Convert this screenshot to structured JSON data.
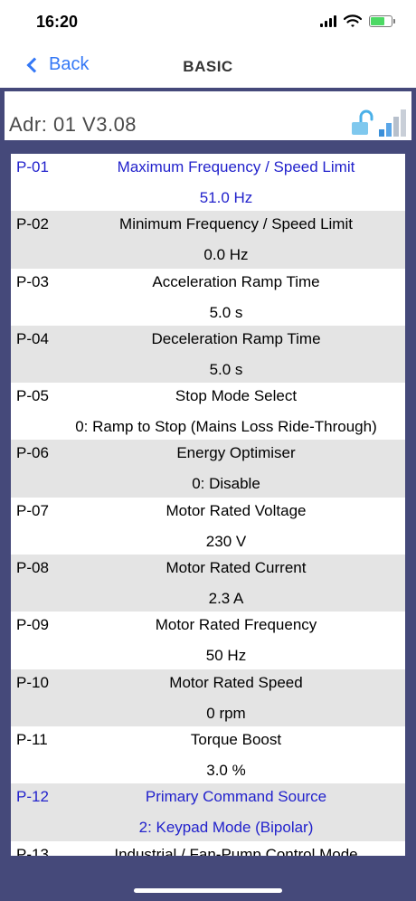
{
  "status_bar": {
    "time": "16:20"
  },
  "nav": {
    "back_label": "Back",
    "title": "BASIC"
  },
  "device": {
    "address": "Adr: 01 V3.08",
    "lock_icon": "unlocked-lock-icon",
    "signal_icon": "signal-strength-icon"
  },
  "colors": {
    "frame": "#45497a",
    "highlight_text": "#2222cc",
    "alt_row": "#e4e4e4",
    "link": "#3478f6"
  },
  "params": [
    {
      "code": "P-01",
      "name": "Maximum Frequency / Speed Limit",
      "value": "51.0 Hz",
      "highlight": true
    },
    {
      "code": "P-02",
      "name": "Minimum Frequency / Speed Limit",
      "value": "0.0 Hz",
      "highlight": false
    },
    {
      "code": "P-03",
      "name": "Acceleration Ramp Time",
      "value": "5.0 s",
      "highlight": false
    },
    {
      "code": "P-04",
      "name": "Deceleration Ramp Time",
      "value": "5.0 s",
      "highlight": false
    },
    {
      "code": "P-05",
      "name": "Stop Mode Select",
      "value": "0: Ramp to Stop (Mains Loss Ride-Through)",
      "highlight": false
    },
    {
      "code": "P-06",
      "name": "Energy Optimiser",
      "value": "0: Disable",
      "highlight": false
    },
    {
      "code": "P-07",
      "name": "Motor Rated Voltage",
      "value": "230 V",
      "highlight": false
    },
    {
      "code": "P-08",
      "name": "Motor Rated Current",
      "value": "2.3 A",
      "highlight": false
    },
    {
      "code": "P-09",
      "name": "Motor Rated Frequency",
      "value": "50 Hz",
      "highlight": false
    },
    {
      "code": "P-10",
      "name": "Motor Rated Speed",
      "value": "0 rpm",
      "highlight": false
    },
    {
      "code": "P-11",
      "name": "Torque Boost",
      "value": "3.0 %",
      "highlight": false
    },
    {
      "code": "P-12",
      "name": "Primary Command Source",
      "value": "2: Keypad Mode (Bipolar)",
      "highlight": true
    },
    {
      "code": "P-13",
      "name": "Industrial / Fan-Pump Control Mode",
      "value": "",
      "highlight": false
    }
  ]
}
